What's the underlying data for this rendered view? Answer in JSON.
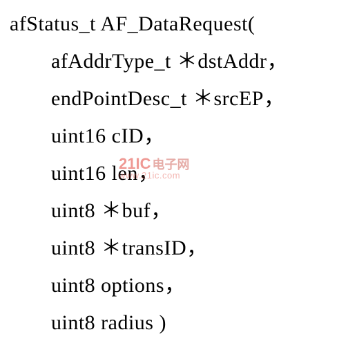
{
  "declaration": "afStatus_t AF_DataRequest(",
  "params": [
    "afAddrType_t ＊dstAddr，",
    "endPointDesc_t ＊srcEP，",
    "uint16 cID，",
    "uint16 len，",
    "uint8 ＊buf，",
    "uint8 ＊transID，",
    "uint8 options，",
    "uint8 radius )"
  ],
  "watermark": {
    "brand": "21IC",
    "suffix": "电子网",
    "url": "www.21ic.com"
  }
}
